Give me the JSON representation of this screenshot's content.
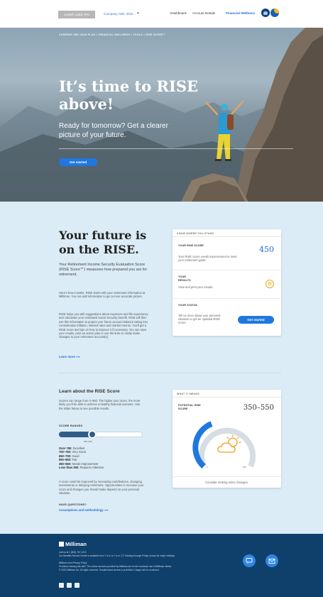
{
  "topnav": {
    "client_logo": "CLIENT LOGO TPO",
    "company": "Company ABC 401k...",
    "links": [
      "Dashboard",
      "Account Details",
      "Financial Wellness"
    ],
    "active_link": "Financial Wellness"
  },
  "hero": {
    "breadcrumb": "COMPANY ABC 401K PLAN  >  FINANCIAL WELLNESS  >  TOOLS  >  RISE SCORE™",
    "title": "It’s time to RISE above!",
    "subtitle": "Ready for tomorrow? Get a clearer picture of your future.",
    "cta": "Get started"
  },
  "intro": {
    "title": "Your future is on the RISE.",
    "lead": "Your Retirement Income Security Evaluation Score (RISE Score℠) measures how prepared you are for retirement.",
    "p1": "Here’s how it works. RISE starts with your retirement information at Milliman. You can add information to get a more accurate picture.",
    "p2": "RISE helps you with suggestions about expenses and life expectancy and calculates your estimated Social Security benefit. RISE will then use this information to project your future account balance taking into consideration inflation, interest rates and market returns. You’ll get a RISE score and tips on how to improve it if necessary. You can save your results, print an action plan or use the links to easily make changes to your retirement account(s).",
    "learn_more": "Learn more ⟶"
  },
  "status_card": {
    "header": "KNOW WHERE YOU STAND",
    "score_label": "YOUR RISE SCORE",
    "score_value": "450",
    "score_desc": "Your RISE Score needs improvement to meet your retirement goals.",
    "results_label": "YOUR RESULTS",
    "results_desc": "View and print your results.",
    "status_label": "YOUR STATUS",
    "status_desc": "Tell us more about your personal situation to get an updated RISE Score.",
    "cta": "Get started",
    "results_icon": "document-icon"
  },
  "learn": {
    "title": "Learn about the RISE Score",
    "desc": "Scores can range from 0–850. The higher your score, the more likely you’ll be able to achieve a healthy financial outcome. Use the slider below to see possible results.",
    "ranges_label": "SCORE RANGES",
    "slider_caption": "350–550",
    "slider_level": 0.41,
    "ranges": [
      {
        "range": "Over 750:",
        "label": "Excellent"
      },
      {
        "range": "700–750:",
        "label": "Very Good"
      },
      {
        "range": "650–700:",
        "label": "Good"
      },
      {
        "range": "550–650:",
        "label": "Fair"
      },
      {
        "range": "350–550:",
        "label": "Needs Improvement"
      },
      {
        "range": "Less than 350:",
        "label": "Requires Attention"
      }
    ],
    "note": "A score could be improved by increasing contributions, changing investments or delaying retirement. Opportunities to increase your score and changes you should make depend on your personal situation.",
    "questions_label": "HAVE QUESTIONS?",
    "assumptions_link": "Assumptions and methodology ⟶"
  },
  "gauge_card": {
    "header": "WHAT IT MEANS",
    "label": "POTENTIAL RISE SCORE",
    "value": "350–550",
    "min": "0",
    "max": "850",
    "icon": "partly-cloudy-icon",
    "footer": "Consider making some changes."
  },
  "footer": {
    "logo": "Milliman",
    "line1": "Call us at 1 (800) 767-1222",
    "line2": "Our Benefits Service Center is available from 7 a.m. to 7 p.m. CT, Monday through Friday, except for major holidays.",
    "line3": "Milliman.com       Privacy Policy",
    "line4": "Problems viewing this site? The online services provided by Milliman are for the exclusive use of Milliman clients.",
    "line5": "© 2019 Milliman Inc. All rights reserved. Unauthorized access is prohibited. Usage will be monitored.",
    "social": [
      "twitter-icon",
      "linkedin-icon",
      "facebook-icon"
    ],
    "buttons": [
      "chat-icon",
      "email-icon"
    ]
  },
  "colors": {
    "accent": "#1f78e0",
    "footer_bg": "#0f3f6b",
    "section_bg": "#dbecf7",
    "gauge_arc": "#1f78e0",
    "sun": "#f0a018"
  }
}
